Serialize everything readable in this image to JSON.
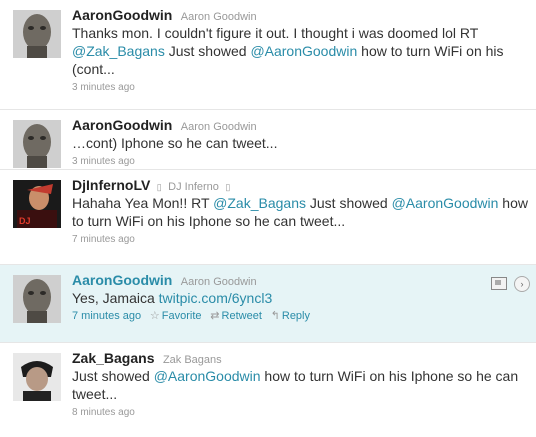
{
  "tweets": [
    {
      "screen_name": "AaronGoodwin",
      "full_name": "Aaron Goodwin",
      "text_parts": [
        {
          "t": "Thanks mon. I couldn't figure it out. I thought i was doomed lol RT "
        },
        {
          "m": "@Zak_Bagans"
        },
        {
          "t": " Just showed "
        },
        {
          "m": "@AaronGoodwin"
        },
        {
          "t": " how to turn WiFi on his (cont..."
        }
      ],
      "time": "3 minutes ago"
    },
    {
      "screen_name": "AaronGoodwin",
      "full_name": "Aaron Goodwin",
      "text": "…cont) Iphone so he can tweet...",
      "time": "3 minutes ago"
    },
    {
      "screen_name": "DjInfernoLV",
      "full_name": "DJ Inferno",
      "glyph_left": "▯",
      "glyph_right": "▯",
      "text_parts": [
        {
          "t": "Hahaha Yea Mon!! RT "
        },
        {
          "m": "@Zak_Bagans"
        },
        {
          "t": " Just showed "
        },
        {
          "m": "@AaronGoodwin"
        },
        {
          "t": " how to turn WiFi on his Iphone so he can tweet..."
        }
      ],
      "time": "7 minutes ago"
    },
    {
      "screen_name": "AaronGoodwin",
      "full_name": "Aaron Goodwin",
      "text_prefix": "Yes, Jamaica ",
      "link": "twitpic.com/6yncl3",
      "time": "7 minutes ago",
      "actions": {
        "favorite": "Favorite",
        "retweet": "Retweet",
        "reply": "Reply"
      }
    },
    {
      "screen_name": "Zak_Bagans",
      "full_name": "Zak Bagans",
      "text_parts": [
        {
          "t": "Just showed "
        },
        {
          "m": "@AaronGoodwin"
        },
        {
          "t": " how to turn WiFi on his Iphone so he can tweet..."
        }
      ],
      "time": "8 minutes ago"
    }
  ],
  "colors": {
    "link": "#2a8ca8",
    "hover_bg": "#e6f4f6"
  },
  "icons": {
    "star": "star-icon",
    "retweet": "retweet-icon",
    "reply": "reply-icon",
    "media": "media-icon",
    "expand": "expand-icon"
  }
}
